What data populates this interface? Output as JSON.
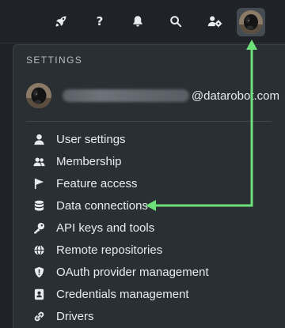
{
  "topbar": {
    "icons": [
      "rocket-icon",
      "help-icon",
      "bell-icon",
      "search-icon",
      "user-settings-icon"
    ],
    "help_glyph": "?"
  },
  "dropdown": {
    "section_title": "SETTINGS",
    "account": {
      "email_domain": "@datarobot.com"
    },
    "items": [
      {
        "label": "User settings",
        "icon": "user-icon"
      },
      {
        "label": "Membership",
        "icon": "users-icon"
      },
      {
        "label": "Feature access",
        "icon": "flag-icon"
      },
      {
        "label": "Data connections",
        "icon": "database-icon"
      },
      {
        "label": "API keys and tools",
        "icon": "key-icon"
      },
      {
        "label": "Remote repositories",
        "icon": "globe-icon"
      },
      {
        "label": "OAuth provider management",
        "icon": "shield-icon"
      },
      {
        "label": "Credentials management",
        "icon": "id-card-icon"
      },
      {
        "label": "Drivers",
        "icon": "link-icon"
      }
    ]
  },
  "colors": {
    "background": "#1f2327",
    "menu_background": "#2a2f34",
    "text": "#e9ecef",
    "annotation_arrow": "#6de07a"
  }
}
